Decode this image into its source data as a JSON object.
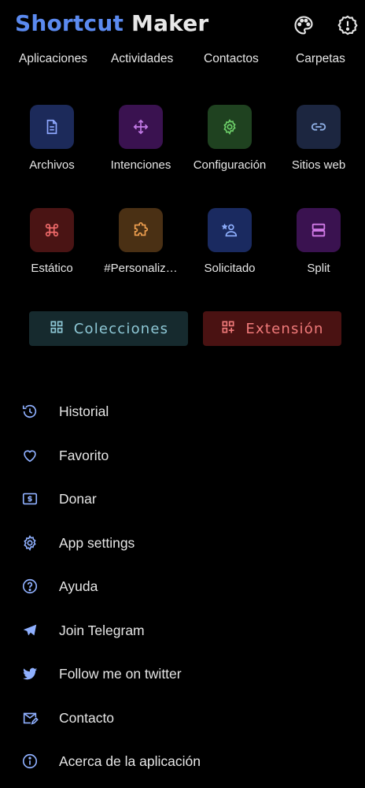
{
  "app": {
    "title_part1": "Shortcut",
    "title_part2": "Maker"
  },
  "header_icons": [
    "palette-icon",
    "settings-alert-icon"
  ],
  "tabs": [
    "Aplicaciones",
    "Actividades",
    "Contactos",
    "Carpetas"
  ],
  "grid": [
    {
      "label": "Archivos",
      "icon": "file-icon",
      "bg": "#1c2a5a",
      "fg": "#8fa8ff"
    },
    {
      "label": "Intenciones",
      "icon": "arrows-icon",
      "bg": "#3a1250",
      "fg": "#c27ae6"
    },
    {
      "label": "Configuración",
      "icon": "gear-icon",
      "bg": "#1f4220",
      "fg": "#6ed06a"
    },
    {
      "label": "Sitios web",
      "icon": "link-icon",
      "bg": "#1c2640",
      "fg": "#8fb0e6"
    },
    {
      "label": "Estático",
      "icon": "command-icon",
      "bg": "#4a1414",
      "fg": "#f06a6a"
    },
    {
      "label": "#Personaliz…",
      "icon": "puzzle-icon",
      "bg": "#4a3014",
      "fg": "#f0a050"
    },
    {
      "label": "Solicitado",
      "icon": "person-star-icon",
      "bg": "#1a2a60",
      "fg": "#8fb0ff"
    },
    {
      "label": "Split",
      "icon": "split-icon",
      "bg": "#3a1250",
      "fg": "#d07ae6"
    }
  ],
  "buttons": {
    "collections": {
      "label": "Colecciones",
      "bg": "#162a2e",
      "fg": "#8ec8d6"
    },
    "extension": {
      "label": "Extensión",
      "bg": "#4a1212",
      "fg": "#f07a7a"
    }
  },
  "menu": [
    {
      "label": "Historial",
      "icon": "history-icon"
    },
    {
      "label": "Favorito",
      "icon": "heart-icon"
    },
    {
      "label": "Donar",
      "icon": "dollar-icon"
    },
    {
      "label": "App settings",
      "icon": "gear-icon"
    },
    {
      "label": "Ayuda",
      "icon": "help-icon"
    },
    {
      "label": "Join Telegram",
      "icon": "telegram-icon"
    },
    {
      "label": "Follow me on twitter",
      "icon": "twitter-icon"
    },
    {
      "label": "Contacto",
      "icon": "mail-edit-icon"
    },
    {
      "label": "Acerca de la aplicación",
      "icon": "info-icon"
    }
  ],
  "colors": {
    "accent": "#5b8af0",
    "menu_icon": "#8fb0ff"
  }
}
